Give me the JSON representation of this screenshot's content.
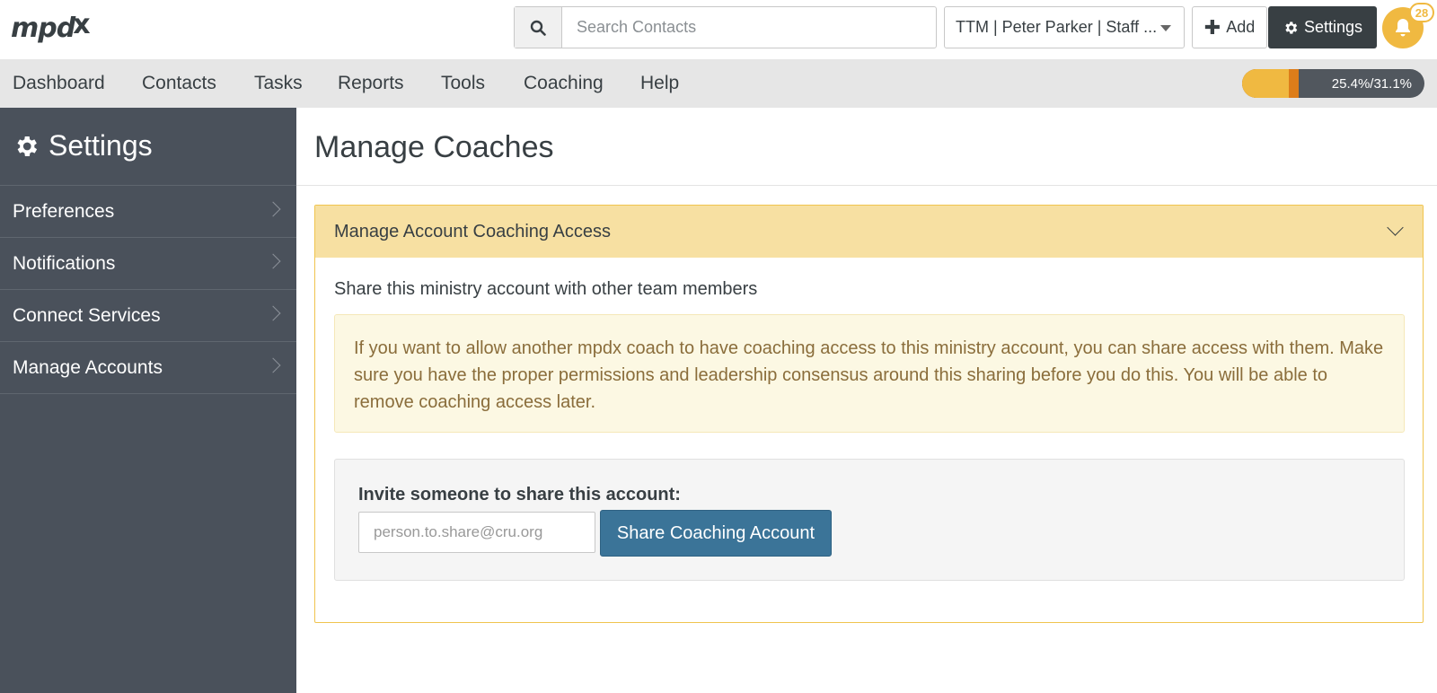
{
  "brand": {
    "logo_text": "mpd",
    "logo_mark": "x"
  },
  "topbar": {
    "search_placeholder": "Search Contacts",
    "account_selected": "TTM | Peter Parker | Staff ...",
    "add_label": "Add",
    "settings_label": "Settings",
    "notification_count": "28"
  },
  "nav": {
    "items": [
      "Dashboard",
      "Contacts",
      "Tasks",
      "Reports",
      "Tools",
      "Coaching",
      "Help"
    ],
    "progress_text": "25.4%/31.1%",
    "progress_primary_percent": 25.4,
    "progress_secondary_percent": 31.1
  },
  "sidebar": {
    "title": "Settings",
    "items": [
      "Preferences",
      "Notifications",
      "Connect Services",
      "Manage Accounts"
    ]
  },
  "main": {
    "page_title": "Manage Coaches",
    "panel_title": "Manage Account Coaching Access",
    "share_description": "Share this ministry account with other team members",
    "alert_text": "If you want to allow another mpdx coach to have coaching access to this ministry account, you can share access with them. Make sure you have the proper permissions and leadership consensus around this sharing before you do this. You will be able to remove coaching access later.",
    "invite_label": "Invite someone to share this account:",
    "email_placeholder": "person.to.share@cru.org",
    "share_button_label": "Share Coaching Account"
  },
  "colors": {
    "accent_yellow": "#f0b941",
    "panel_header": "#f7e0a2",
    "sidebar_bg": "#4a515b",
    "primary_button": "#3b7498",
    "alert_text": "#8a6d3b"
  },
  "icons": [
    "search-icon",
    "chevron-down-icon",
    "plus-icon",
    "gear-icon",
    "bell-icon",
    "chevron-right-icon"
  ]
}
